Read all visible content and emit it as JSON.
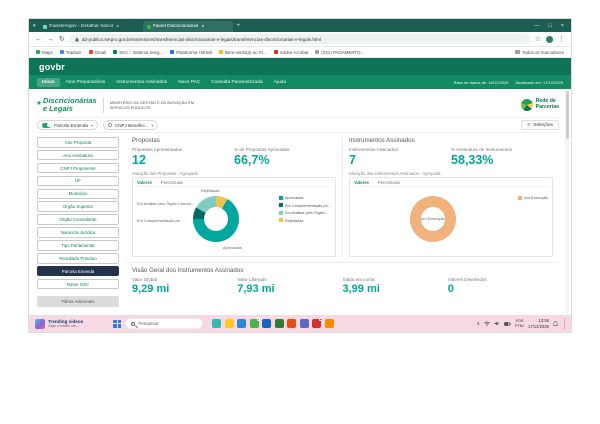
{
  "icons": {
    "tab_search": "▾",
    "close_tab": "×",
    "new_tab": "+",
    "minimize": "—",
    "maximize": "□",
    "close_window": "×",
    "back": "←",
    "forward": "→",
    "refresh": "↻",
    "star": "☆",
    "menu": "⋮",
    "caret_down": "▾",
    "burger": "≡",
    "chevron_up": "∧",
    "brand_star": "*"
  },
  "browser": {
    "tabs": [
      {
        "title": "Transferegov - Detalhar Solicit",
        "favicon_color": "#7fd1c0"
      },
      {
        "title": "Painel Discricionárias",
        "favicon_color": "#39b54a"
      }
    ],
    "url": "dd-publico.serpro.gov.br/extensions/transferencias-discricionarias-e-legais/transferencias-discricionarias-e-legais.html",
    "bookmarks": [
      {
        "label": "Maps",
        "color": "#34a853"
      },
      {
        "label": "Traduzir",
        "color": "#4285f4"
      },
      {
        "label": "Gmail",
        "color": "#ea4335"
      },
      {
        "label": "SICI :: Sistema Integ...",
        "color": "#0b8043"
      },
      {
        "label": "Plataforma +Brasil",
        "color": "#1a73e8"
      },
      {
        "label": "Bem-vindo(a) ao SI...",
        "color": "#fbbc04"
      },
      {
        "label": "Adobe Acrobat",
        "color": "#d93025"
      },
      {
        "label": "(231) PAGAMENTO...",
        "color": "#9aa0a6"
      }
    ],
    "bookmarks_more": "Todos os marcadores"
  },
  "govbr": {
    "logo": "govbr"
  },
  "nav": {
    "items": [
      "Início",
      "Atos Preparatórios",
      "Instrumentos Assinados",
      "Novo PAC",
      "Consulta Parametrizada",
      "Ajuda"
    ],
    "base_date": "Base de dados de: 16/12/2025",
    "updated": "Atualizado em: 17/12/2025"
  },
  "masthead": {
    "brand_line1": "Discricionárias",
    "brand_line2": "e Legais",
    "ministry": "Ministério da Gestão e da Inovação em Serviços Públicos",
    "rede_line1": "Rede de",
    "rede_line2": "Parcerias"
  },
  "chips": {
    "chip1": "Parcela Emenda",
    "chip2": "CNPJ Benefici...",
    "selections": "Seleções"
  },
  "sidebar": {
    "items": [
      "Ano Proposta",
      "Ano Assinatura",
      "CNPJ Proponente",
      "UF",
      "Município",
      "Órgão Superior",
      "Órgão Concedente",
      "Natureza Jurídica",
      "Tipo Parlamentar",
      "Resultado Primário",
      "Parcela Emenda",
      "Nome OSC"
    ],
    "selected": "Parcela Emenda",
    "extra": "Filtros Adicionais"
  },
  "propostas": {
    "title": "Propostas",
    "kpi1_label": "Propostas Apresentadas",
    "kpi1_value": "12",
    "kpi2_label": "% de Propostas Aprovadas",
    "kpi2_value": "66,7%"
  },
  "instrumentos": {
    "title": "Instrumentos Assinados",
    "kpi1_label": "Instrumentos Assinados",
    "kpi1_value": "7",
    "kpi2_label": "% Assinatura de Instrumentos",
    "kpi2_value": "58,33%"
  },
  "chart_data": [
    {
      "type": "pie",
      "title": "Situação das Propostas - Agrupada",
      "tabs": [
        "Valores",
        "Percentuais"
      ],
      "total": 12,
      "segments": [
        {
          "label": "Rejeitadas",
          "value": 1,
          "color": "#f2c14e"
        },
        {
          "label": "Aprovadas",
          "value": 8,
          "color": "#00a79d"
        },
        {
          "label": "Em Complementação pelo Proponente",
          "value": 1,
          "color": "#046a5f"
        },
        {
          "label": "Em Análise pelo Órgão Concedente",
          "value": 2,
          "color": "#7fccc3"
        }
      ],
      "callouts": [
        "Rejeitadas",
        "Em Análise pelo Órgão Conced...",
        "Em Complementação pe...",
        "Aprovadas"
      ],
      "legend": [
        {
          "label": "Aprovadas",
          "color": "#00a79d"
        },
        {
          "label": "Em Complementação pe...",
          "color": "#046a5f"
        },
        {
          "label": "Em Análise pelo Órgão...",
          "color": "#7fccc3"
        },
        {
          "label": "Rejeitadas",
          "color": "#f2c14e"
        }
      ],
      "legend_position": "right"
    },
    {
      "type": "pie",
      "title": "Situação dos Instrumentos Assinados - Agrupada",
      "tabs": [
        "Valores",
        "Percentuais"
      ],
      "total": 7,
      "segments": [
        {
          "label": "em Execução",
          "value": 7,
          "color": "#f2b27d"
        }
      ],
      "center_label": "em Execução",
      "legend": [
        {
          "label": "em Execução",
          "color": "#f2b27d"
        }
      ],
      "legend_position": "right"
    }
  ],
  "visao_geral": {
    "title": "Visão Geral dos Instrumentos Assinados",
    "kpis": [
      {
        "label": "Valor Global",
        "value": "9,29 mi"
      },
      {
        "label": "Valor Liberado",
        "value": "7,93 mi"
      },
      {
        "label": "Saldo em conta",
        "value": "3,99 mi"
      },
      {
        "label": "Valores Devolvidos",
        "value": "0"
      }
    ]
  },
  "taskbar": {
    "widget_line1": "Trending videos",
    "widget_line2": "Veja o trailer de...",
    "search_placeholder": "Pesquisar",
    "apps": [
      {
        "name": "widgets-app",
        "color": "#35b8b1"
      },
      {
        "name": "file-explorer",
        "color": "#ffca28"
      },
      {
        "name": "edge-browser",
        "color": "#2f86d6"
      },
      {
        "name": "chrome-browser",
        "color": "#4caf50",
        "badge": true
      },
      {
        "name": "outlook",
        "color": "#1565c0"
      },
      {
        "name": "excel",
        "color": "#2e7d32"
      },
      {
        "name": "powerpoint",
        "color": "#e64a19"
      },
      {
        "name": "teams",
        "color": "#5c6bc0"
      },
      {
        "name": "acrobat",
        "color": "#d32f2f",
        "badge": true
      },
      {
        "name": "snipping-tool",
        "color": "#fb8c00"
      }
    ],
    "lang_line1": "POR",
    "lang_line2": "PTB2",
    "time": "13:55",
    "date": "17/12/2025"
  },
  "colors": {
    "accent_teal": "#00a79c",
    "gov_green_dark": "#0d7457",
    "gov_green": "#128a63",
    "browser_frame": "#1d5e52",
    "selected_filter_navy": "#26324a",
    "taskbar_pink": "#f6d9e3"
  }
}
